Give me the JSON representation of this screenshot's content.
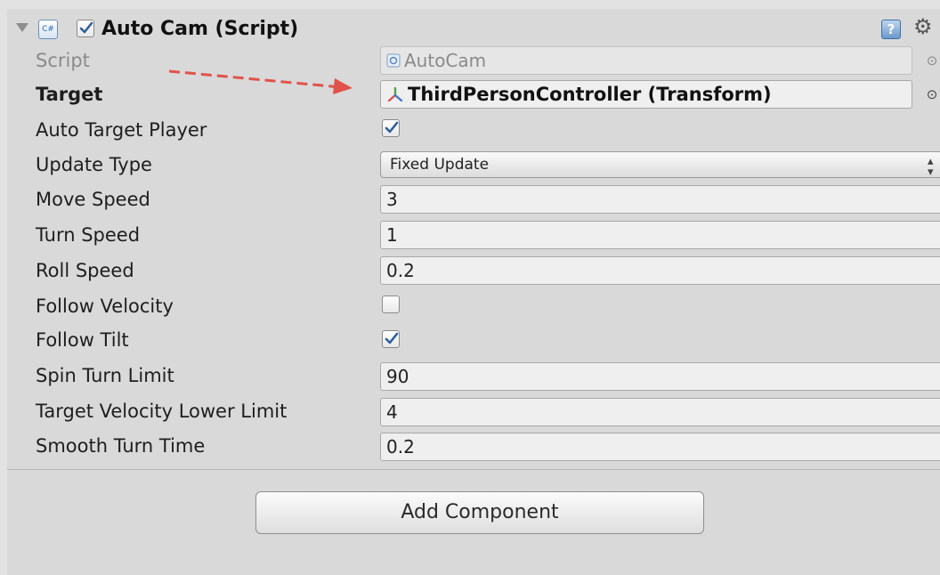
{
  "component": {
    "title": "Auto Cam (Script)",
    "enabled": true,
    "script_icon_glyph": "C#",
    "help_glyph": "?",
    "settings_glyph": "⚙"
  },
  "properties": {
    "script": {
      "label": "Script",
      "value": "AutoCam"
    },
    "target": {
      "label": "Target",
      "value": "ThirdPersonController (Transform)"
    },
    "auto_target_player": {
      "label": "Auto Target Player",
      "checked": true
    },
    "update_type": {
      "label": "Update Type",
      "value": "Fixed Update"
    },
    "move_speed": {
      "label": "Move Speed",
      "value": "3"
    },
    "turn_speed": {
      "label": "Turn Speed",
      "value": "1"
    },
    "roll_speed": {
      "label": "Roll Speed",
      "value": "0.2"
    },
    "follow_velocity": {
      "label": "Follow Velocity",
      "checked": false
    },
    "follow_tilt": {
      "label": "Follow Tilt",
      "checked": true
    },
    "spin_turn_limit": {
      "label": "Spin Turn Limit",
      "value": "90"
    },
    "target_velocity_lower_limit": {
      "label": "Target Velocity Lower Limit",
      "value": "4"
    },
    "smooth_turn_time": {
      "label": "Smooth Turn Time",
      "value": "0.2"
    }
  },
  "footer": {
    "add_component_label": "Add Component"
  },
  "colors": {
    "checkmark": "#2f5f9e",
    "annotation_arrow": "#e0534a",
    "panel_bg": "#d9d9d9"
  }
}
